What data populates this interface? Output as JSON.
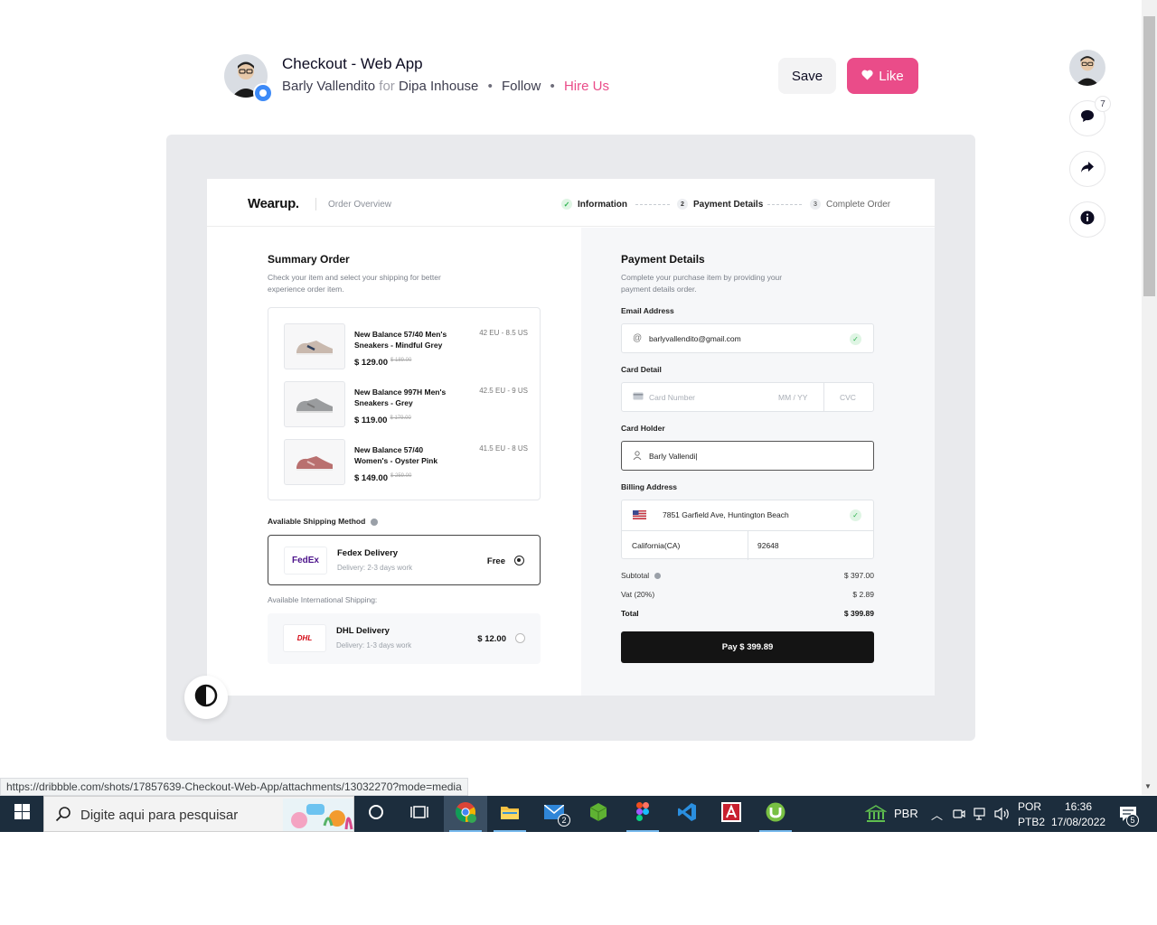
{
  "header": {
    "title": "Checkout - Web App",
    "author": "Barly Vallendito",
    "for_word": "for",
    "team": "Dipa Inhouse",
    "follow": "Follow",
    "hire": "Hire Us",
    "save_label": "Save",
    "like_label": "Like"
  },
  "rail": {
    "comment_count": "7"
  },
  "shot": {
    "brand": "Wearup.",
    "order_overview": "Order Overview",
    "steps": [
      {
        "num": "",
        "label": "Information",
        "done": true
      },
      {
        "num": "2",
        "label": "Payment Details",
        "done": false
      },
      {
        "num": "3",
        "label": "Complete Order",
        "done": false
      }
    ],
    "summary": {
      "title": "Summary Order",
      "subtitle_1": "Check your item and select your shipping for better",
      "subtitle_2": "experience order item.",
      "items": [
        {
          "name": "New Balance 57/40 Men's Sneakers - Mindful Grey",
          "size": "42 EU - 8.5 US",
          "price": "$ 129.00",
          "old_price": "$ 189.00",
          "color": "#c9b9ae"
        },
        {
          "name": "New Balance 997H Men's Sneakers - Grey",
          "size": "42.5 EU - 9 US",
          "price": "$ 119.00",
          "old_price": "$ 179.00",
          "color": "#9a9c9e"
        },
        {
          "name": "New Balance 57/40 Women's - Oyster Pink",
          "size": "41.5 EU - 8 US",
          "price": "$ 149.00",
          "old_price": "$ 259.00",
          "color": "#b9706f"
        }
      ],
      "shipping_label": "Avaliable Shipping Method",
      "intl_label": "Available International Shipping:",
      "shipping": [
        {
          "logo": "FedEx",
          "name": "Fedex Delivery",
          "delivery": "Delivery: 2-3 days work",
          "price": "Free",
          "selected": true
        },
        {
          "logo": "DHL",
          "name": "DHL Delivery",
          "delivery": "Delivery: 1-3 days work",
          "price": "$ 12.00",
          "selected": false
        }
      ]
    },
    "payment": {
      "title": "Payment Details",
      "subtitle_1": "Complete your purchase item by providing your",
      "subtitle_2": "payment details order.",
      "email_label": "Email Address",
      "email_value": "barlyvallendito@gmail.com",
      "card_label": "Card Detail",
      "card_number_ph": "Card Number",
      "card_exp_ph": "MM / YY",
      "card_cvc_ph": "CVC",
      "holder_label": "Card Holder",
      "holder_value": "Barly Vallendi|",
      "billing_label": "Billing Address",
      "billing_street": "7851 Garfield Ave, Huntington Beach",
      "billing_state": "California(CA)",
      "billing_zip": "92648",
      "subtotal_label": "Subtotal",
      "subtotal_value": "$ 397.00",
      "vat_label": "Vat (20%)",
      "vat_value": "$ 2.89",
      "total_label": "Total",
      "total_value": "$ 399.89",
      "pay_label": "Pay $ 399.89"
    }
  },
  "status_url": "https://dribbble.com/shots/17857639-Checkout-Web-App/attachments/13032270?mode=media",
  "taskbar": {
    "search_placeholder": "Digite aqui para pesquisar",
    "mail_badge": "2",
    "bank_label": "PBR",
    "lang_1": "POR",
    "lang_2": "PTB2",
    "time": "16:36",
    "date": "17/08/2022",
    "notif_count": "5"
  },
  "colors": {
    "accent": "#ea4c89",
    "taskbar": "#1c2d3d",
    "pay_button": "#141414"
  }
}
